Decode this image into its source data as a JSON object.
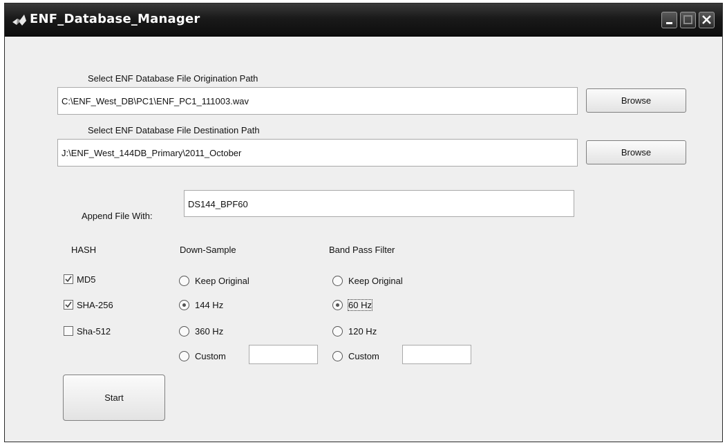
{
  "window": {
    "title": "ENF_Database_Manager"
  },
  "origination": {
    "label": "Select ENF Database File Origination Path",
    "value": "C:\\ENF_West_DB\\PC1\\ENF_PC1_111003.wav",
    "browse": "Browse"
  },
  "destination": {
    "label": "Select ENF Database File Destination Path",
    "value": "J:\\ENF_West_144DB_Primary\\2011_October",
    "browse": "Browse"
  },
  "append": {
    "label": "Append File With:",
    "value": "DS144_BPF60"
  },
  "hash": {
    "header": "HASH",
    "options": [
      {
        "label": "MD5",
        "checked": true
      },
      {
        "label": "SHA-256",
        "checked": true
      },
      {
        "label": "Sha-512",
        "checked": false
      }
    ]
  },
  "downsample": {
    "header": "Down-Sample",
    "options": [
      "Keep Original",
      "144 Hz",
      "360 Hz",
      "Custom"
    ],
    "selected": "144 Hz",
    "custom_value": ""
  },
  "bandpass": {
    "header": "Band Pass Filter",
    "options": [
      "Keep Original",
      "60 Hz",
      "120 Hz",
      "Custom"
    ],
    "selected": "60 Hz",
    "custom_value": ""
  },
  "start_label": "Start"
}
